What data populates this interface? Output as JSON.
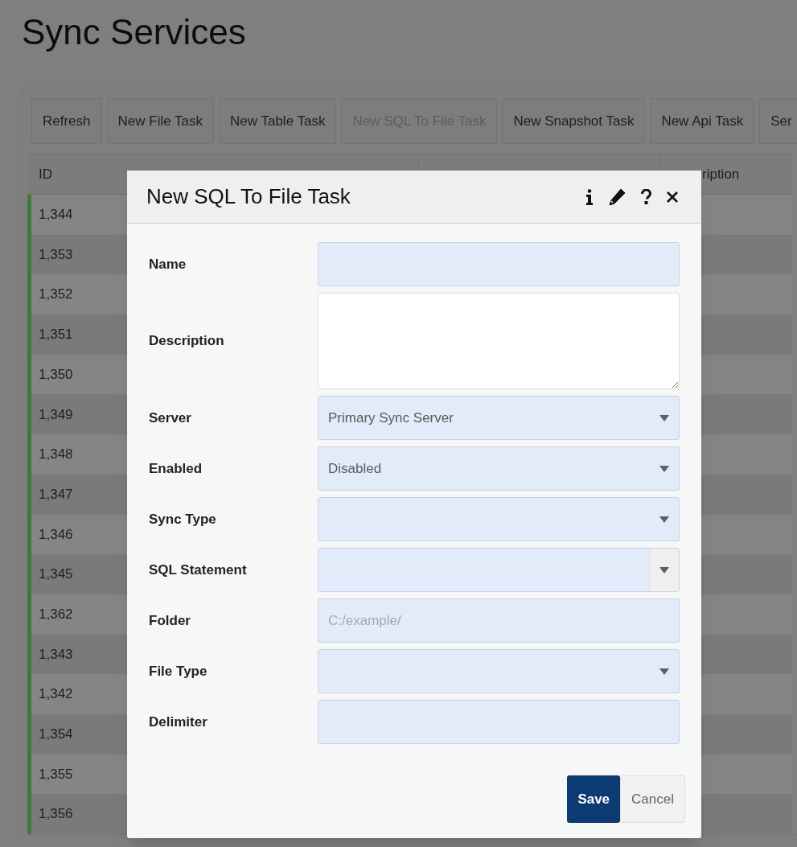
{
  "page": {
    "title": "Sync Services"
  },
  "toolbar": [
    {
      "label": "Refresh",
      "disabled": false
    },
    {
      "label": "New File Task",
      "disabled": false
    },
    {
      "label": "New Table Task",
      "disabled": false
    },
    {
      "label": "New SQL To File Task",
      "disabled": true
    },
    {
      "label": "New Snapshot Task",
      "disabled": false
    },
    {
      "label": "New Api Task",
      "disabled": false
    },
    {
      "label": "Ser",
      "disabled": false
    }
  ],
  "table": {
    "columns": [
      "ID",
      "ription"
    ],
    "rows": [
      {
        "id": "1,344"
      },
      {
        "id": "1,353"
      },
      {
        "id": "1,352"
      },
      {
        "id": "1,351"
      },
      {
        "id": "1,350"
      },
      {
        "id": "1,349"
      },
      {
        "id": "1,348"
      },
      {
        "id": "1,347"
      },
      {
        "id": "1,346"
      },
      {
        "id": "1,345"
      },
      {
        "id": "1,362"
      },
      {
        "id": "1,343"
      },
      {
        "id": "1,342"
      },
      {
        "id": "1,354"
      },
      {
        "id": "1,355"
      },
      {
        "id": "1,356"
      }
    ]
  },
  "dialog": {
    "title": "New SQL To File Task",
    "fields": [
      {
        "label": "Name",
        "kind": "text"
      },
      {
        "label": "Description",
        "kind": "textarea"
      },
      {
        "label": "Server",
        "kind": "select",
        "value": "Primary Sync Server"
      },
      {
        "label": "Enabled",
        "kind": "select",
        "value": "Disabled"
      },
      {
        "label": "Sync Type",
        "kind": "select"
      },
      {
        "label": "SQL Statement",
        "kind": "combo"
      },
      {
        "label": "Folder",
        "kind": "text",
        "placeholder": "C:/example/"
      },
      {
        "label": "File Type",
        "kind": "select"
      },
      {
        "label": "Delimiter",
        "kind": "text"
      }
    ],
    "buttons": [
      {
        "label": "Save",
        "kind": "primary"
      },
      {
        "label": "Cancel",
        "kind": "secondary"
      }
    ]
  }
}
